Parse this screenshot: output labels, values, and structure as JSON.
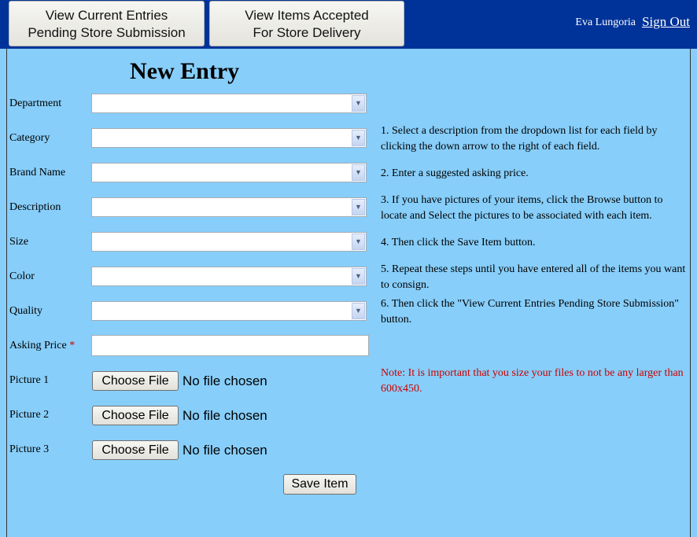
{
  "header": {
    "nav_buttons": [
      {
        "line1": "View Current Entries",
        "line2": "Pending Store Submission"
      },
      {
        "line1": "View Items Accepted",
        "line2": "For Store Delivery"
      }
    ],
    "user_name": "Eva Lungoria",
    "sign_out": "Sign Out"
  },
  "form": {
    "title": "New Entry",
    "fields": [
      {
        "label": "Department",
        "value": ""
      },
      {
        "label": "Category",
        "value": ""
      },
      {
        "label": "Brand Name",
        "value": ""
      },
      {
        "label": "Description",
        "value": ""
      },
      {
        "label": "Size",
        "value": ""
      },
      {
        "label": "Color",
        "value": ""
      },
      {
        "label": "Quality",
        "value": ""
      }
    ],
    "asking_price": {
      "label": "Asking Price",
      "required_mark": "*",
      "value": ""
    },
    "pictures": [
      {
        "label": "Picture 1",
        "button": "Choose File",
        "status": "No file chosen"
      },
      {
        "label": "Picture 2",
        "button": "Choose File",
        "status": "No file chosen"
      },
      {
        "label": "Picture 3",
        "button": "Choose File",
        "status": "No file chosen"
      }
    ],
    "save_label": "Save Item"
  },
  "instructions": [
    "1. Select a description from the dropdown list for each field by clicking the down arrow to the right of each field.",
    "2. Enter a suggested asking price.",
    "3. If you have pictures of your items, click the Browse button to locate and Select the pictures to be associated with each item.",
    "4. Then click the Save Item button.",
    "5. Repeat these steps until you have entered all of the items you want to consign.",
    "6. Then click the \"View Current Entries Pending Store Submission\" button."
  ],
  "note": "Note: It is important that you size your files to not be any larger than 600x450.",
  "colors": {
    "header_bg": "#003399",
    "page_bg": "#87cefa",
    "required": "#cc0000",
    "note": "#cc0000"
  },
  "icons": {
    "dropdown": "chevron-down-icon"
  }
}
